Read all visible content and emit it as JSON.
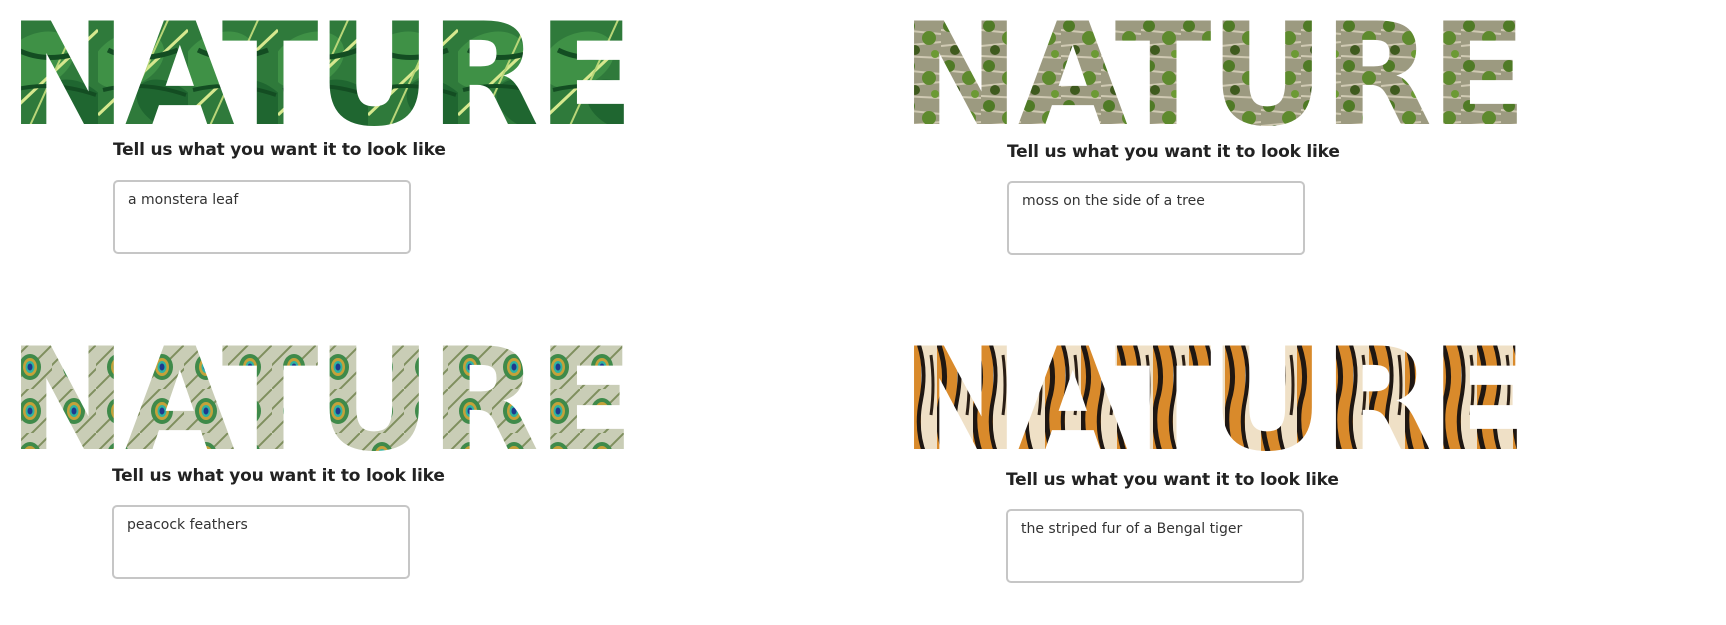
{
  "panels": [
    {
      "word": "NATURE",
      "texture": "monstera-leaf",
      "colors": {
        "base": "#2f7a3b",
        "light": "#8fc06a",
        "dark": "#134d22",
        "vein": "#d7e88e"
      },
      "prompt_label": "Tell us what you want it to look like",
      "prompt_value": "a monstera leaf"
    },
    {
      "word": "NATURE",
      "texture": "moss-on-bark",
      "colors": {
        "base": "#6a7a3a",
        "light": "#b9b49a",
        "dark": "#3f5a1e",
        "vein": "#e6e2d0"
      },
      "prompt_label": "Tell us what you want it to look like",
      "prompt_value": "moss on the side of a tree"
    },
    {
      "word": "NATURE",
      "texture": "peacock-feathers",
      "colors": {
        "base": "#6f8a55",
        "light": "#d9e0c6",
        "dark": "#1e4e6e",
        "vein": "#2fb3a0"
      },
      "prompt_label": "Tell us what you want it to look like",
      "prompt_value": "peacock feathers"
    },
    {
      "word": "NATURE",
      "texture": "tiger-stripes",
      "colors": {
        "base": "#d98a2b",
        "light": "#f1e3cc",
        "dark": "#1f1712",
        "vein": "#f6efe3"
      },
      "prompt_label": "Tell us what you want it to look like",
      "prompt_value": "the striped fur of a Bengal tiger"
    }
  ]
}
